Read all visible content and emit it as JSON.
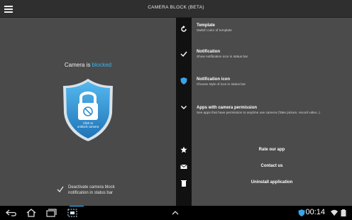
{
  "app": {
    "title": "CAMERA BLOCK (BETA)"
  },
  "left": {
    "status_prefix": "Camera is ",
    "status_value": "blocked",
    "shield_text_1": "Click to",
    "shield_text_2": "unblock camera",
    "deactivate_line1": "Deactivate camera block",
    "deactivate_line2": "notification in status bar"
  },
  "settings": [
    {
      "title": "Template",
      "desc": "Switch color of template",
      "icon": "refresh-icon"
    },
    {
      "title": "Notification",
      "desc": "Show notification icon in status bar",
      "icon": "check-icon"
    },
    {
      "title": "Notification icon",
      "desc": "Choose style of icon in status bar",
      "icon": "shield-icon"
    },
    {
      "title": "Apps with camera permission",
      "desc": "See apps that have permission to anytime use camera (Take picture, record video..)",
      "icon": "chevron-down-icon"
    }
  ],
  "links": {
    "rate": "Rate our app",
    "contact": "Contact us",
    "uninstall": "Uninstall application"
  },
  "system_bar": {
    "time": "00:14"
  },
  "colors": {
    "accent": "#39b2ee",
    "shield": "#2f8fd0"
  }
}
